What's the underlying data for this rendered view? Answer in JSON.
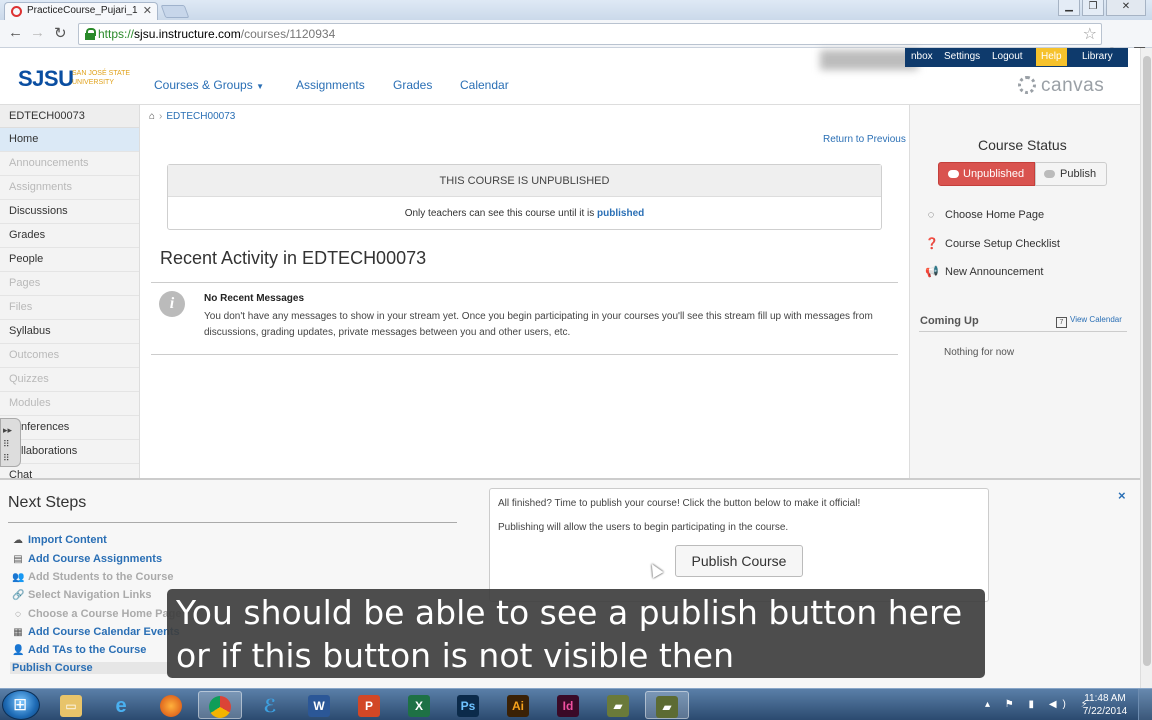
{
  "browser": {
    "tab_title": "PracticeCourse_Pujari_1",
    "url_scheme": "https://",
    "url_host": "sjsu.instructure.com",
    "url_path": "/courses/1120934"
  },
  "header": {
    "logo": "SJSU",
    "logo_sub": "SAN JOSÉ STATE UNIVERSITY",
    "nav": [
      "Courses & Groups",
      "Assignments",
      "Grades",
      "Calendar"
    ],
    "top_links": [
      "nbox",
      "Settings",
      "Logout",
      "Help",
      "Library"
    ],
    "brand": "canvas"
  },
  "sidebar": {
    "course_code": "EDTECH00073",
    "items": [
      {
        "label": "Home",
        "state": "active"
      },
      {
        "label": "Announcements",
        "state": "dim"
      },
      {
        "label": "Assignments",
        "state": "dim"
      },
      {
        "label": "Discussions",
        "state": "normal"
      },
      {
        "label": "Grades",
        "state": "normal"
      },
      {
        "label": "People",
        "state": "normal"
      },
      {
        "label": "Pages",
        "state": "dim"
      },
      {
        "label": "Files",
        "state": "dim"
      },
      {
        "label": "Syllabus",
        "state": "normal"
      },
      {
        "label": "Outcomes",
        "state": "dim"
      },
      {
        "label": "Quizzes",
        "state": "dim"
      },
      {
        "label": "Modules",
        "state": "dim"
      },
      {
        "label": "nferences",
        "state": "normal"
      },
      {
        "label": "llaborations",
        "state": "normal"
      },
      {
        "label": "Chat",
        "state": "normal"
      }
    ]
  },
  "main": {
    "breadcrumb": "EDTECH00073",
    "return_link": "Return to Previous",
    "unpublished_heading": "THIS COURSE IS UNPUBLISHED",
    "unpublished_text": "Only teachers can see this course until it is",
    "unpublished_link": "published",
    "recent_title": "Recent Activity in EDTECH00073",
    "no_recent_title": "No Recent Messages",
    "no_recent_text": "You don't have any messages to show in your stream yet. Once you begin participating in your courses you'll see this stream fill up with messages from discussions, grading updates, private messages between you and other users, etc."
  },
  "right_sidebar": {
    "course_status_title": "Course Status",
    "unpublished_btn": "Unpublished",
    "publish_btn": "Publish",
    "actions": [
      "Choose Home Page",
      "Course Setup Checklist",
      "New Announcement"
    ],
    "coming_up": "Coming Up",
    "view_calendar": "View Calendar",
    "nothing": "Nothing for now"
  },
  "next_steps": {
    "title": "Next Steps",
    "items": [
      {
        "label": "Import Content",
        "state": "link"
      },
      {
        "label": "Add Course Assignments",
        "state": "link"
      },
      {
        "label": "Add Students to the Course",
        "state": "dim"
      },
      {
        "label": "Select Navigation Links",
        "state": "dim"
      },
      {
        "label": "Choose a Course Home Page",
        "state": "dim"
      },
      {
        "label": "Add Course Calendar Events",
        "state": "link"
      },
      {
        "label": "Add TAs to the Course",
        "state": "link"
      },
      {
        "label": "Publish Course",
        "state": "selected"
      }
    ],
    "close": "×",
    "finish_line1": "All finished? Time to publish your course! Click the button below to make it official!",
    "finish_line2": "Publishing will allow the users to begin participating in the course.",
    "publish_course_btn": "Publish Course"
  },
  "caption": {
    "line1": "You should be able to see a publish button here",
    "line2": "or if this button is not visible then"
  },
  "taskbar": {
    "time": "11:48 AM",
    "date": "7/22/2014"
  }
}
